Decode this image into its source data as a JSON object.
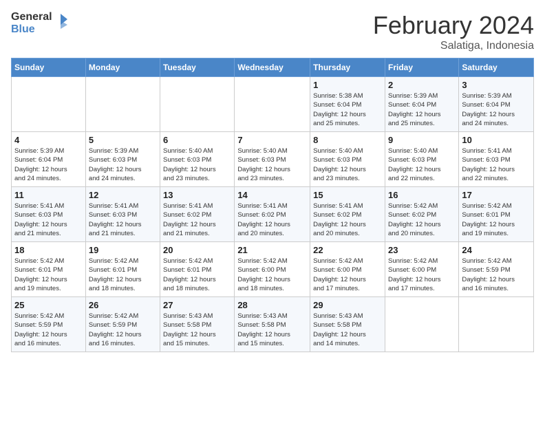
{
  "logo": {
    "line1": "General",
    "line2": "Blue"
  },
  "title": "February 2024",
  "subtitle": "Salatiga, Indonesia",
  "days_of_week": [
    "Sunday",
    "Monday",
    "Tuesday",
    "Wednesday",
    "Thursday",
    "Friday",
    "Saturday"
  ],
  "weeks": [
    [
      {
        "day": "",
        "info": ""
      },
      {
        "day": "",
        "info": ""
      },
      {
        "day": "",
        "info": ""
      },
      {
        "day": "",
        "info": ""
      },
      {
        "day": "1",
        "info": "Sunrise: 5:38 AM\nSunset: 6:04 PM\nDaylight: 12 hours\nand 25 minutes."
      },
      {
        "day": "2",
        "info": "Sunrise: 5:39 AM\nSunset: 6:04 PM\nDaylight: 12 hours\nand 25 minutes."
      },
      {
        "day": "3",
        "info": "Sunrise: 5:39 AM\nSunset: 6:04 PM\nDaylight: 12 hours\nand 24 minutes."
      }
    ],
    [
      {
        "day": "4",
        "info": "Sunrise: 5:39 AM\nSunset: 6:04 PM\nDaylight: 12 hours\nand 24 minutes."
      },
      {
        "day": "5",
        "info": "Sunrise: 5:39 AM\nSunset: 6:03 PM\nDaylight: 12 hours\nand 24 minutes."
      },
      {
        "day": "6",
        "info": "Sunrise: 5:40 AM\nSunset: 6:03 PM\nDaylight: 12 hours\nand 23 minutes."
      },
      {
        "day": "7",
        "info": "Sunrise: 5:40 AM\nSunset: 6:03 PM\nDaylight: 12 hours\nand 23 minutes."
      },
      {
        "day": "8",
        "info": "Sunrise: 5:40 AM\nSunset: 6:03 PM\nDaylight: 12 hours\nand 23 minutes."
      },
      {
        "day": "9",
        "info": "Sunrise: 5:40 AM\nSunset: 6:03 PM\nDaylight: 12 hours\nand 22 minutes."
      },
      {
        "day": "10",
        "info": "Sunrise: 5:41 AM\nSunset: 6:03 PM\nDaylight: 12 hours\nand 22 minutes."
      }
    ],
    [
      {
        "day": "11",
        "info": "Sunrise: 5:41 AM\nSunset: 6:03 PM\nDaylight: 12 hours\nand 21 minutes."
      },
      {
        "day": "12",
        "info": "Sunrise: 5:41 AM\nSunset: 6:03 PM\nDaylight: 12 hours\nand 21 minutes."
      },
      {
        "day": "13",
        "info": "Sunrise: 5:41 AM\nSunset: 6:02 PM\nDaylight: 12 hours\nand 21 minutes."
      },
      {
        "day": "14",
        "info": "Sunrise: 5:41 AM\nSunset: 6:02 PM\nDaylight: 12 hours\nand 20 minutes."
      },
      {
        "day": "15",
        "info": "Sunrise: 5:41 AM\nSunset: 6:02 PM\nDaylight: 12 hours\nand 20 minutes."
      },
      {
        "day": "16",
        "info": "Sunrise: 5:42 AM\nSunset: 6:02 PM\nDaylight: 12 hours\nand 20 minutes."
      },
      {
        "day": "17",
        "info": "Sunrise: 5:42 AM\nSunset: 6:01 PM\nDaylight: 12 hours\nand 19 minutes."
      }
    ],
    [
      {
        "day": "18",
        "info": "Sunrise: 5:42 AM\nSunset: 6:01 PM\nDaylight: 12 hours\nand 19 minutes."
      },
      {
        "day": "19",
        "info": "Sunrise: 5:42 AM\nSunset: 6:01 PM\nDaylight: 12 hours\nand 18 minutes."
      },
      {
        "day": "20",
        "info": "Sunrise: 5:42 AM\nSunset: 6:01 PM\nDaylight: 12 hours\nand 18 minutes."
      },
      {
        "day": "21",
        "info": "Sunrise: 5:42 AM\nSunset: 6:00 PM\nDaylight: 12 hours\nand 18 minutes."
      },
      {
        "day": "22",
        "info": "Sunrise: 5:42 AM\nSunset: 6:00 PM\nDaylight: 12 hours\nand 17 minutes."
      },
      {
        "day": "23",
        "info": "Sunrise: 5:42 AM\nSunset: 6:00 PM\nDaylight: 12 hours\nand 17 minutes."
      },
      {
        "day": "24",
        "info": "Sunrise: 5:42 AM\nSunset: 5:59 PM\nDaylight: 12 hours\nand 16 minutes."
      }
    ],
    [
      {
        "day": "25",
        "info": "Sunrise: 5:42 AM\nSunset: 5:59 PM\nDaylight: 12 hours\nand 16 minutes."
      },
      {
        "day": "26",
        "info": "Sunrise: 5:42 AM\nSunset: 5:59 PM\nDaylight: 12 hours\nand 16 minutes."
      },
      {
        "day": "27",
        "info": "Sunrise: 5:43 AM\nSunset: 5:58 PM\nDaylight: 12 hours\nand 15 minutes."
      },
      {
        "day": "28",
        "info": "Sunrise: 5:43 AM\nSunset: 5:58 PM\nDaylight: 12 hours\nand 15 minutes."
      },
      {
        "day": "29",
        "info": "Sunrise: 5:43 AM\nSunset: 5:58 PM\nDaylight: 12 hours\nand 14 minutes."
      },
      {
        "day": "",
        "info": ""
      },
      {
        "day": "",
        "info": ""
      }
    ]
  ]
}
